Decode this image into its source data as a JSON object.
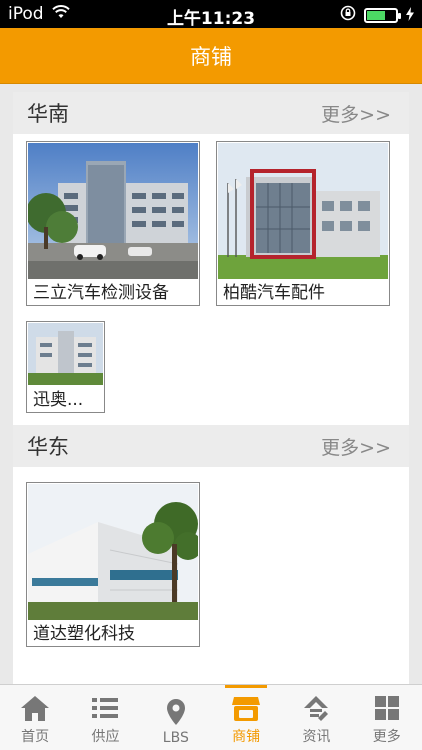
{
  "status_bar": {
    "carrier": "iPod",
    "time": "上午11:23"
  },
  "nav": {
    "title": "商铺"
  },
  "sections": [
    {
      "title": "华南",
      "more": "更多>>",
      "items": [
        {
          "caption": "三立汽车检测设备"
        },
        {
          "caption": "柏酷汽车配件"
        },
        {
          "caption": "迅奥..."
        }
      ]
    },
    {
      "title": "华东",
      "more": "更多>>",
      "items": [
        {
          "caption": "道达塑化科技"
        }
      ]
    }
  ],
  "tabs": [
    {
      "label": "首页",
      "icon": "home-icon"
    },
    {
      "label": "供应",
      "icon": "list-icon"
    },
    {
      "label": "LBS",
      "icon": "location-pin-icon"
    },
    {
      "label": "商铺",
      "icon": "shop-icon",
      "active": true
    },
    {
      "label": "资讯",
      "icon": "news-icon"
    },
    {
      "label": "更多",
      "icon": "grid-icon"
    }
  ],
  "colors": {
    "accent": "#f39a00",
    "status_bar": "#000000",
    "battery": "#4cd964"
  }
}
